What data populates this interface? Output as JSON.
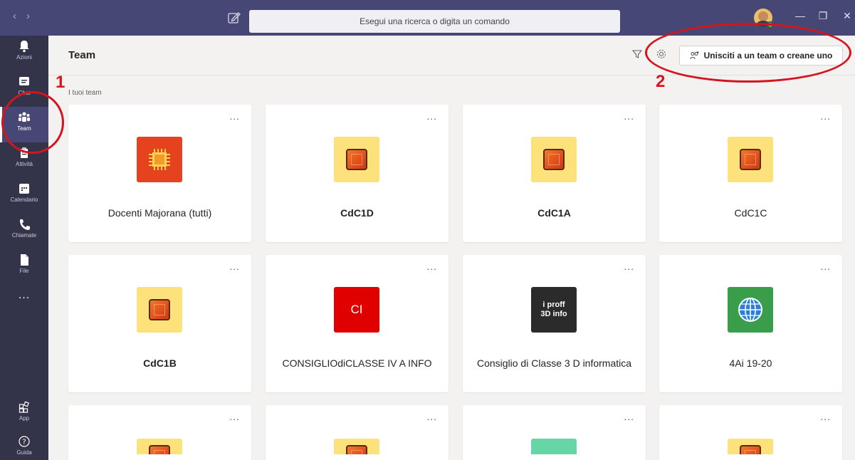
{
  "titlebar": {
    "search_placeholder": "Esegui una ricerca o digita un comando",
    "back_icon": "chevron-left-icon",
    "forward_icon": "chevron-right-icon"
  },
  "rail": {
    "items": [
      {
        "label": "Azioni",
        "icon": "bell-icon"
      },
      {
        "label": "Chat",
        "icon": "chat-icon"
      },
      {
        "label": "Team",
        "icon": "team-icon",
        "active": true
      },
      {
        "label": "Attività",
        "icon": "assignments-icon"
      },
      {
        "label": "Calendario",
        "icon": "calendar-icon"
      },
      {
        "label": "Chiamate",
        "icon": "phone-icon"
      },
      {
        "label": "File",
        "icon": "file-icon"
      }
    ],
    "more": "...",
    "bottom": [
      {
        "label": "App",
        "icon": "apps-icon"
      },
      {
        "label": "Guida",
        "icon": "help-icon"
      }
    ]
  },
  "header": {
    "title": "Team",
    "join_button": "Unisciti a un team o creane uno"
  },
  "section": {
    "label": "I tuoi team"
  },
  "teams": [
    {
      "name": "Docenti Majorana (tutti)",
      "bold": false,
      "tile": "red-chip"
    },
    {
      "name": "CdC1D",
      "bold": true,
      "tile": "orange"
    },
    {
      "name": "CdC1A",
      "bold": true,
      "tile": "orange"
    },
    {
      "name": "CdC1C",
      "bold": false,
      "tile": "orange"
    },
    {
      "name": "CdC1B",
      "bold": true,
      "tile": "orange"
    },
    {
      "name": "CONSIGLIOdiCLASSE IV A INFO",
      "bold": false,
      "tile": "red",
      "tile_text": "CI"
    },
    {
      "name": "Consiglio di Classe 3 D informatica",
      "bold": false,
      "tile": "dark",
      "tile_text_1": "i proff",
      "tile_text_2": "3D info"
    },
    {
      "name": "4Ai 19-20",
      "bold": false,
      "tile": "globe"
    }
  ],
  "more_menu": "...",
  "annotations": [
    "1",
    "2"
  ],
  "colors": {
    "titlebar": "#464775",
    "rail": "#33344a",
    "annotation": "#d4151d"
  }
}
